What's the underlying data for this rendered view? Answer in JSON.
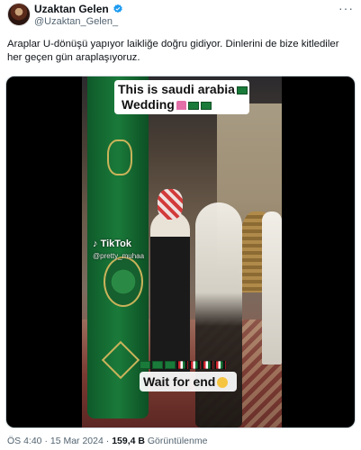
{
  "author": {
    "display_name": "Uzaktan Gelen",
    "handle": "@Uzaktan_Gelen_",
    "verified": true,
    "avatar_icon": "avatar-photo"
  },
  "more_menu_icon": "more-dots-icon",
  "tweet": {
    "text": "Araplar U-dönüşü yapıyor laikliğe doğru gidiyor.  Dinlerini de bize kitlediler her geçen gün araplaşıyoruz."
  },
  "video": {
    "caption_line1": "This is saudi arabia",
    "caption_line2": "Wedding",
    "watermark": "TikTok",
    "watermark_handle": "@pretty_muhaa",
    "bottom_caption": "Wait for end"
  },
  "footer": {
    "time": "ÖS 4:40",
    "separator": "·",
    "date": "15 Mar 2024",
    "views_count": "159,4 B",
    "views_label": "Görüntülenme"
  },
  "colors": {
    "text_primary": "#0f1419",
    "text_secondary": "#536471",
    "verified_blue": "#1d9bf0",
    "flag_green": "#1a7a3a"
  }
}
